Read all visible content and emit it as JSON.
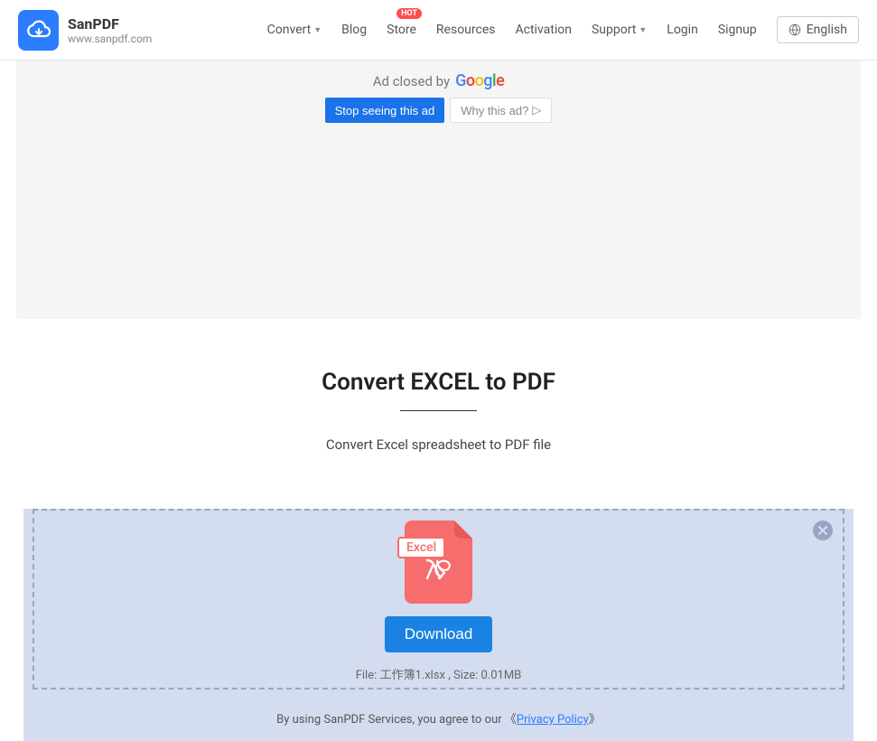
{
  "brand": {
    "name": "SanPDF",
    "url": "www.sanpdf.com"
  },
  "nav": {
    "convert": "Convert",
    "blog": "Blog",
    "store": "Store",
    "store_badge": "HOT",
    "resources": "Resources",
    "activation": "Activation",
    "support": "Support",
    "login": "Login",
    "signup": "Signup",
    "language": "English"
  },
  "ad": {
    "closed_text": "Ad closed by",
    "stop_btn": "Stop seeing this ad",
    "why_btn": "Why this ad?"
  },
  "page": {
    "title": "Convert EXCEL to PDF",
    "subtitle": "Convert Excel spreadsheet to PDF file"
  },
  "file": {
    "badge": "Excel",
    "download": "Download",
    "info": "File: 工作簿1.xlsx , Size: 0.01MB"
  },
  "policy": {
    "prefix": "By using SanPDF Services, you agree to our  《",
    "link": "Privacy Policy",
    "suffix": "》"
  }
}
